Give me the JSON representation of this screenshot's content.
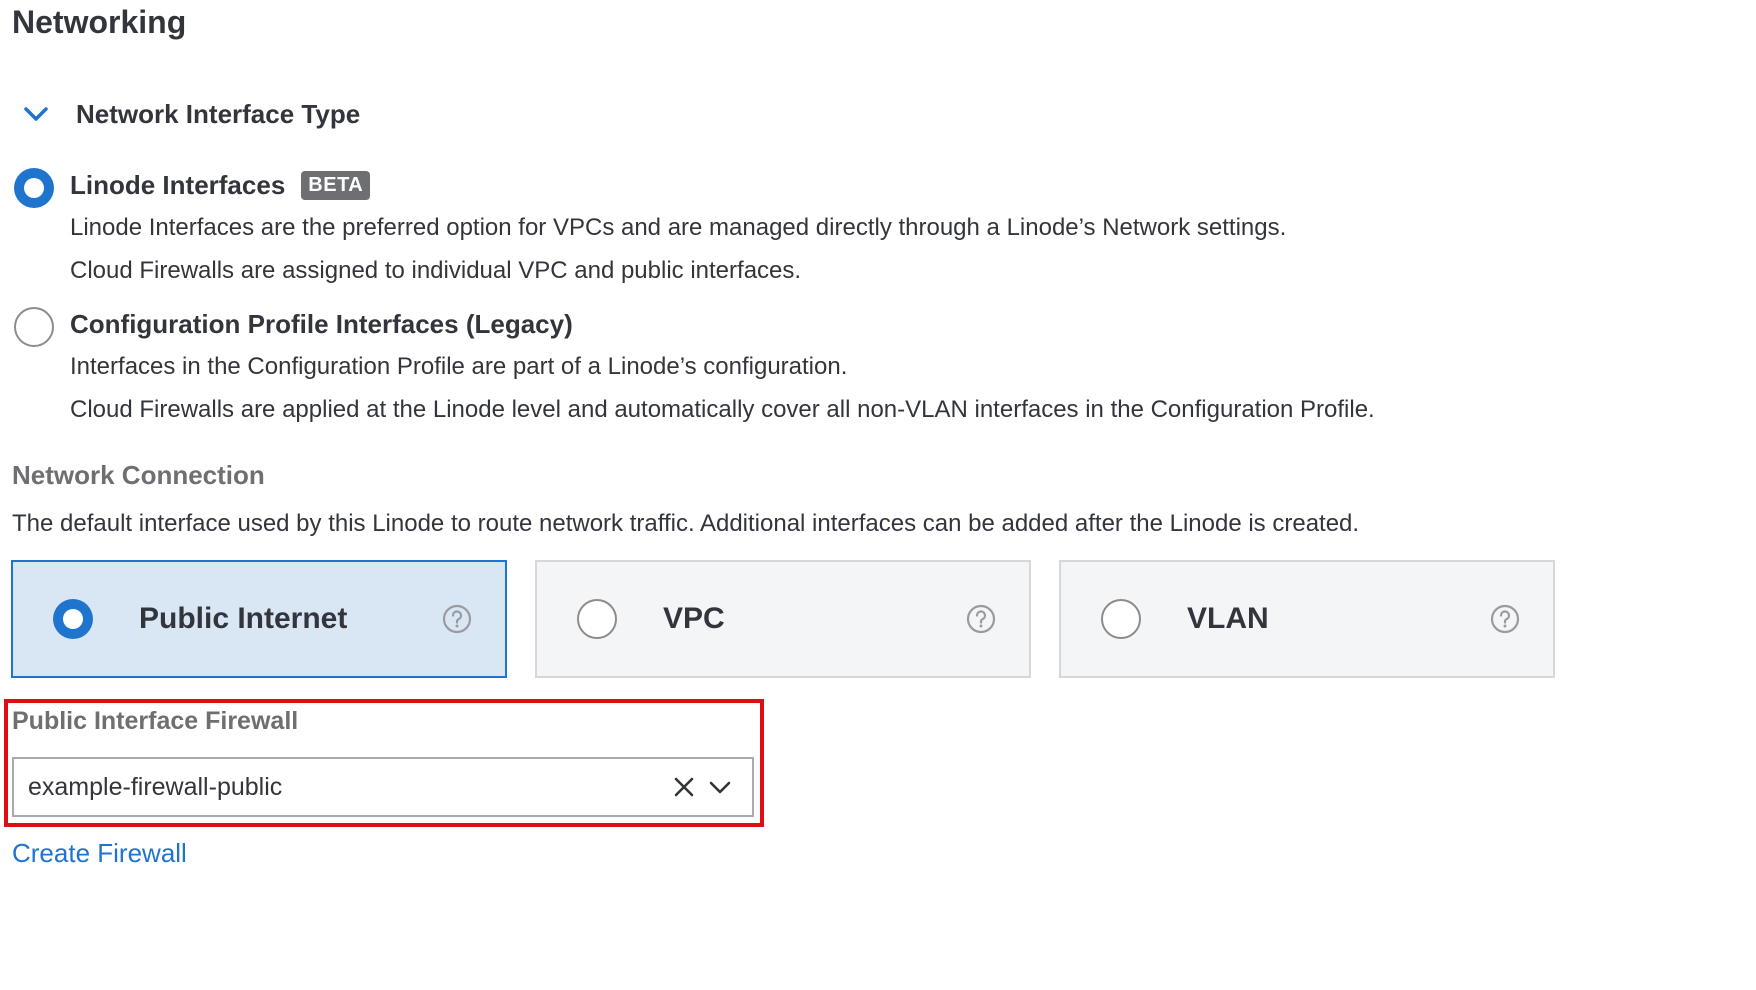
{
  "page": {
    "title": "Networking"
  },
  "interface_type": {
    "toggle_label": "Network Interface Type",
    "options": [
      {
        "title": "Linode Interfaces",
        "badge": "BETA",
        "checked": true,
        "lines": [
          "Linode Interfaces are the preferred option for VPCs and are managed directly through a Linode’s Network settings.",
          "Cloud Firewalls are assigned to individual VPC and public interfaces."
        ]
      },
      {
        "title": "Configuration Profile Interfaces (Legacy)",
        "checked": false,
        "lines": [
          "Interfaces in the Configuration Profile are part of a Linode’s configuration.",
          "Cloud Firewalls are applied at the Linode level and automatically cover all non-VLAN interfaces in the Configuration Profile."
        ]
      }
    ]
  },
  "network_connection": {
    "heading": "Network Connection",
    "description": "The default interface used by this Linode to route network traffic. Additional interfaces can be added after the Linode is created.",
    "cards": [
      {
        "label": "Public Internet",
        "selected": true
      },
      {
        "label": "VPC",
        "selected": false
      },
      {
        "label": "VLAN",
        "selected": false
      }
    ]
  },
  "firewall": {
    "label": "Public Interface Firewall",
    "value": "example-firewall-public",
    "create_link": "Create Firewall"
  },
  "colors": {
    "accent": "#1f75cd",
    "highlight": "#e20d12",
    "selected_card_bg": "#d9e7f5",
    "card_bg": "#f4f5f6"
  }
}
